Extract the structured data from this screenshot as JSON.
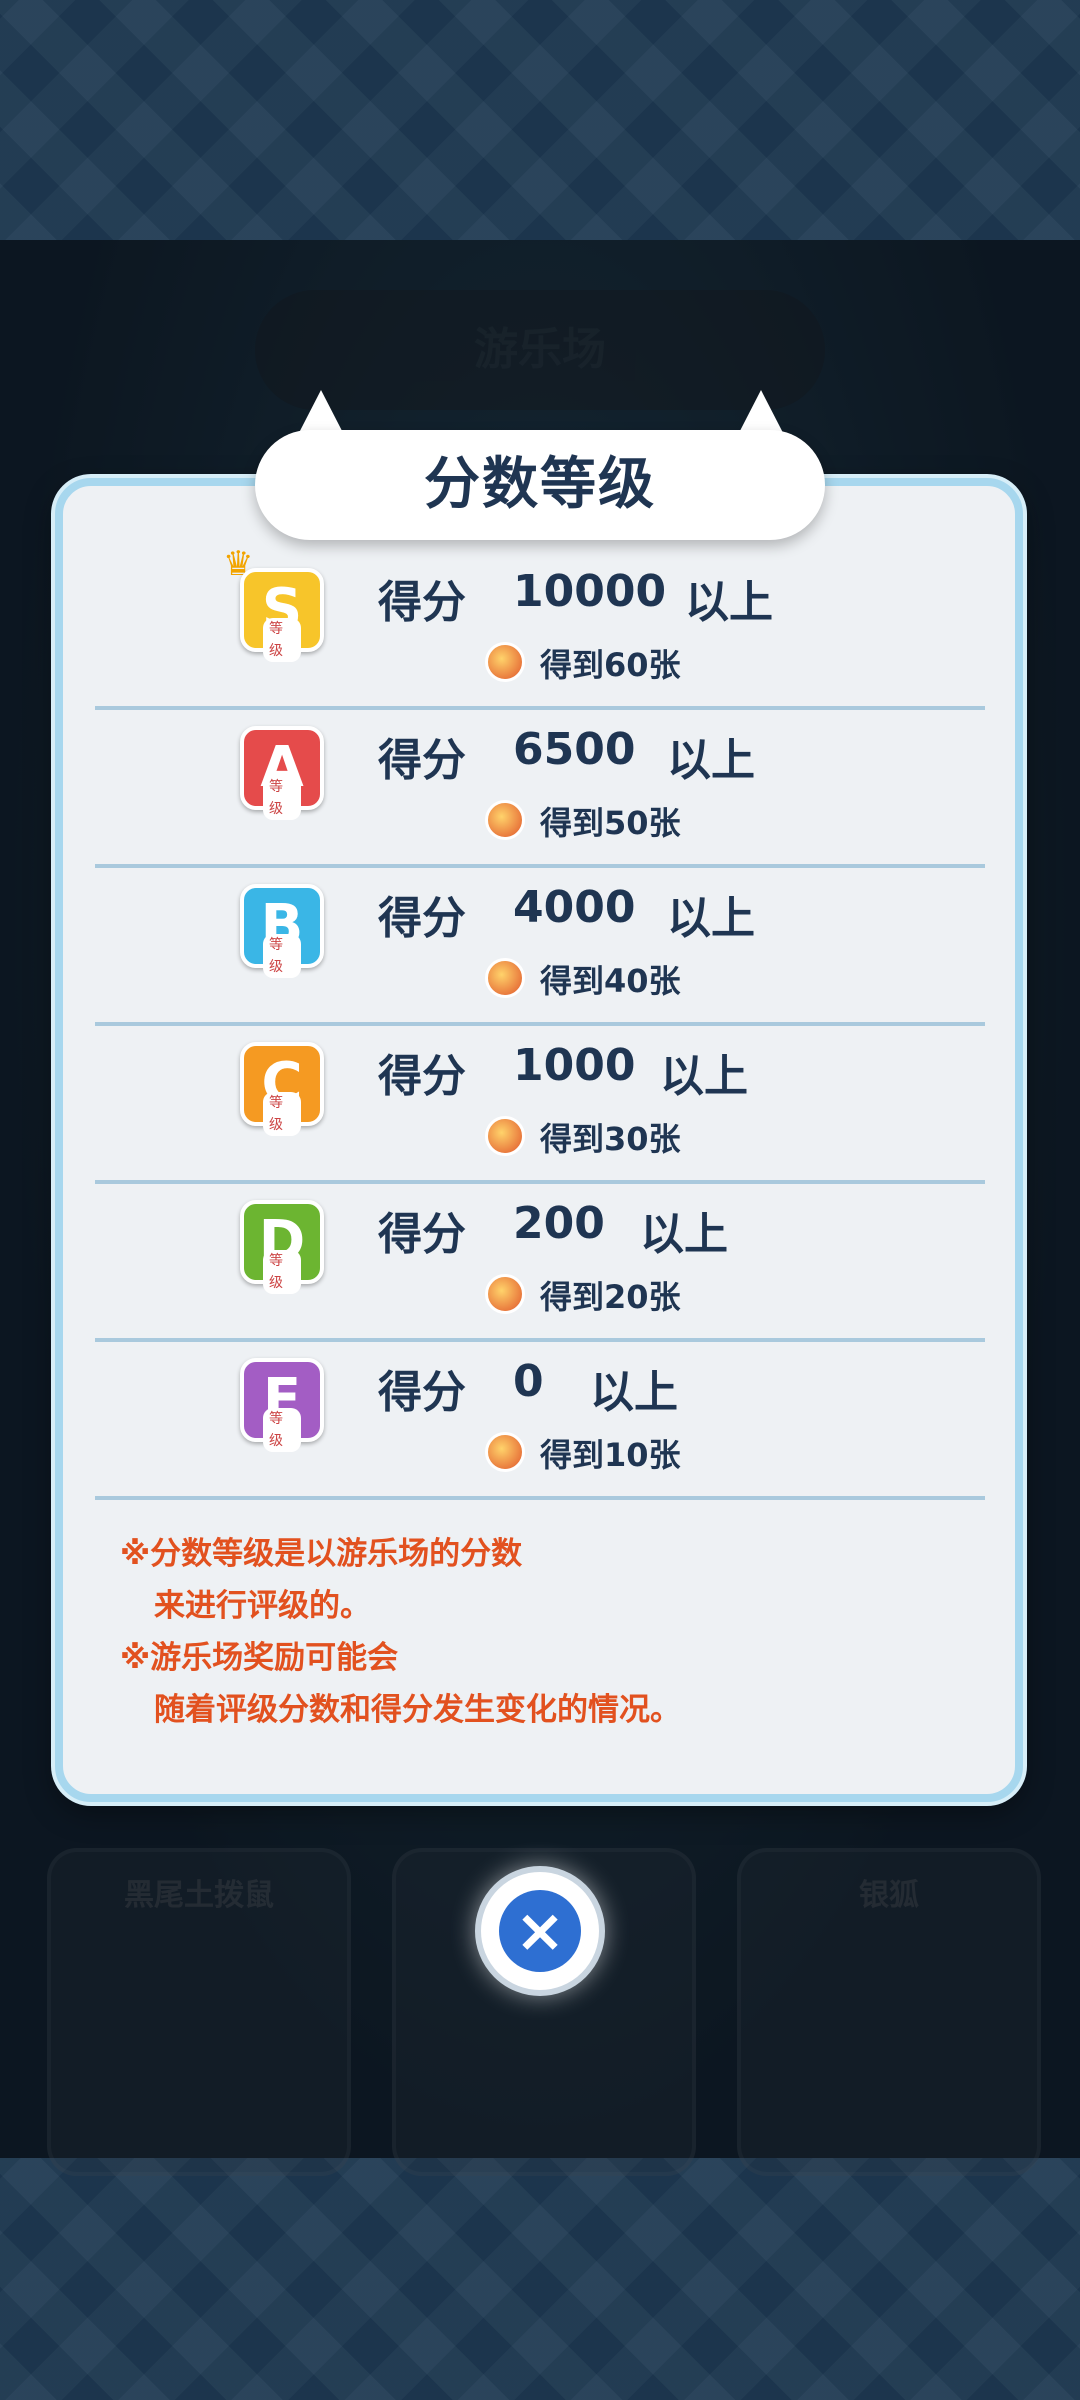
{
  "background": {
    "title_tab": "游乐场",
    "cards": [
      "黑尾土拨鼠",
      "银狐"
    ]
  },
  "modal": {
    "title": "分数等级",
    "rows": [
      {
        "grade": "S",
        "grade_tag": "等级",
        "label": "得分",
        "score": "10000",
        "suffix": "以上",
        "reward": "得到60张",
        "color": "#f7c52a"
      },
      {
        "grade": "A",
        "grade_tag": "等级",
        "label": "得分",
        "score": "6500",
        "suffix": "以上",
        "reward": "得到50张",
        "color": "#e54b4b"
      },
      {
        "grade": "B",
        "grade_tag": "等级",
        "label": "得分",
        "score": "4000",
        "suffix": "以上",
        "reward": "得到40张",
        "color": "#3ab6e6"
      },
      {
        "grade": "C",
        "grade_tag": "等级",
        "label": "得分",
        "score": "1000",
        "suffix": "以上",
        "reward": "得到30张",
        "color": "#f59a22"
      },
      {
        "grade": "D",
        "grade_tag": "等级",
        "label": "得分",
        "score": "200",
        "suffix": "以上",
        "reward": "得到20张",
        "color": "#6cb531"
      },
      {
        "grade": "E",
        "grade_tag": "等级",
        "label": "得分",
        "score": "0",
        "suffix": "以上",
        "reward": "得到10张",
        "color": "#a35dc4"
      }
    ],
    "notes": [
      "※分数等级是以游乐场的分数",
      "来进行评级的。",
      "※游乐场奖励可能会",
      "随着评级分数和得分发生变化的情况。"
    ]
  },
  "close_icon": "×"
}
